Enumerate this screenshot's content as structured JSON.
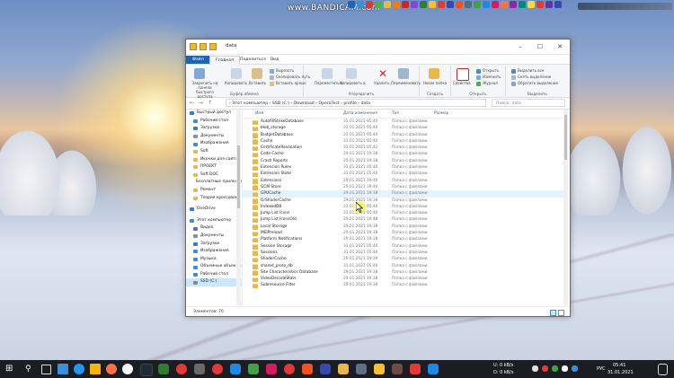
{
  "watermark": "www.BANDICAM.com",
  "window": {
    "title": "data",
    "tabs": [
      "Файл",
      "Главная",
      "Поделиться",
      "Вид"
    ],
    "ribbon": {
      "clipboard": {
        "pin": "Закрепить на панели быстрого доступа",
        "copy": "Копировать",
        "paste": "Вставить",
        "cut": "Вырезать",
        "copy_path": "Скопировать путь",
        "paste_shortcut": "Вставить ярлык",
        "group": "Буфер обмена"
      },
      "organize": {
        "move": "Переместить в",
        "copy": "Копировать в",
        "delete": "Удалить",
        "rename": "Переименовать",
        "group": "Упорядочить"
      },
      "new": {
        "folder": "Новая папка",
        "group": "Создать"
      },
      "open": {
        "properties": "Свойства",
        "open": "Открыть",
        "edit": "Изменить",
        "history": "Журнал",
        "group": "Открыть"
      },
      "select": {
        "all": "Выделить все",
        "none": "Снять выделение",
        "invert": "Обратить выделение",
        "group": "Выделить"
      }
    },
    "address": {
      "path": "› Этот компьютер  ›  SSD (C:)  ›  Download  ›  OperaTest  ›  profile  ›  data",
      "search_placeholder": "Поиск: data"
    },
    "nav_items": [
      {
        "label": "Быстрый доступ",
        "color": "#2f7fd8"
      },
      {
        "label": "Рабочий стол",
        "color": "#3b8fd9"
      },
      {
        "label": "Загрузки",
        "color": "#2f7fd8"
      },
      {
        "label": "Документы",
        "color": "#7f93a8"
      },
      {
        "label": "Изображения",
        "color": "#3b8fd9"
      },
      {
        "label": "Soft",
        "color": "#e9b84a"
      },
      {
        "label": "Иконки для сайта",
        "color": "#e9b84a"
      },
      {
        "label": "ПРОЕКТ",
        "color": "#e9b84a"
      },
      {
        "label": "Soft DOC",
        "color": "#e9b84a"
      },
      {
        "label": "Бесплатные приложения",
        "color": "#e9b84a"
      },
      {
        "label": "Ремонт",
        "color": "#e9b84a"
      },
      {
        "label": "Теория кроссовок",
        "color": "#e9b84a"
      },
      {
        "label": "OneDrive",
        "color": "#2f7fd8"
      },
      {
        "label": "Этот компьютер",
        "color": "#3b8fd9"
      },
      {
        "label": "Видео",
        "color": "#6a6aa8"
      },
      {
        "label": "Документы",
        "color": "#7f93a8"
      },
      {
        "label": "Загрузки",
        "color": "#2f7fd8"
      },
      {
        "label": "Изображения",
        "color": "#3b8fd9"
      },
      {
        "label": "Музыка",
        "color": "#3b8fd9"
      },
      {
        "label": "Объемные объекты",
        "color": "#3b8fd9"
      },
      {
        "label": "Рабочий стол",
        "color": "#3b8fd9"
      },
      {
        "label": "SSD (C:)",
        "color": "#888888"
      }
    ],
    "columns": {
      "name": "Имя",
      "date": "Дата изменения",
      "type": "Тип",
      "size": "Размер"
    },
    "files": [
      {
        "name": "AutofillStrikeDatabase",
        "date": "31.01.2021 05:40",
        "type": "Папка с файлами"
      },
      {
        "name": "blob_storage",
        "date": "31.01.2021 05:40",
        "type": "Папка с файлами"
      },
      {
        "name": "BudgetDatabase",
        "date": "31.01.2021 05:40",
        "type": "Папка с файлами"
      },
      {
        "name": "Cache",
        "date": "31.01.2021 05:40",
        "type": "Папка с файлами"
      },
      {
        "name": "CertificateRevocation",
        "date": "31.01.2021 05:41",
        "type": "Папка с файлами"
      },
      {
        "name": "Code Cache",
        "date": "29.01.2021 19:38",
        "type": "Папка с файлами"
      },
      {
        "name": "Crash Reports",
        "date": "29.01.2021 19:38",
        "type": "Папка с файлами"
      },
      {
        "name": "Extension Rules",
        "date": "31.01.2021 05:40",
        "type": "Папка с файлами"
      },
      {
        "name": "Extension State",
        "date": "31.01.2021 05:40",
        "type": "Папка с файлами"
      },
      {
        "name": "Extensions",
        "date": "29.01.2021 19:46",
        "type": "Папка с файлами"
      },
      {
        "name": "GCM Store",
        "date": "29.01.2021 19:40",
        "type": "Папка с файлами"
      },
      {
        "name": "GPUCache",
        "date": "29.01.2021 19:38",
        "type": "Папка с файлами"
      },
      {
        "name": "GrShaderCache",
        "date": "29.01.2021 19:38",
        "type": "Папка с файлами"
      },
      {
        "name": "IndexedDB",
        "date": "31.01.2021 05:40",
        "type": "Папка с файлами"
      },
      {
        "name": "Jump List Icons",
        "date": "31.01.2021 05:40",
        "type": "Папка с файлами"
      },
      {
        "name": "Jump List IconsOld",
        "date": "29.01.2021 19:48",
        "type": "Папка с файлами"
      },
      {
        "name": "Local Storage",
        "date": "29.01.2021 19:38",
        "type": "Папка с файлами"
      },
      {
        "name": "MEIPreload",
        "date": "29.01.2021 19:38",
        "type": "Папка с файлами"
      },
      {
        "name": "Platform Notifications",
        "date": "29.01.2021 19:38",
        "type": "Папка с файлами"
      },
      {
        "name": "Session Storage",
        "date": "31.01.2021 05:40",
        "type": "Папка с файлами"
      },
      {
        "name": "Sessions",
        "date": "31.01.2021 05:40",
        "type": "Папка с файлами"
      },
      {
        "name": "ShaderCache",
        "date": "29.01.2021 19:39",
        "type": "Папка с файлами"
      },
      {
        "name": "shared_proto_db",
        "date": "31.01.2021 05:40",
        "type": "Папка с файлами"
      },
      {
        "name": "Site Characteristics Database",
        "date": "29.01.2021 19:38",
        "type": "Папка с файлами"
      },
      {
        "name": "VideoDecodeStats",
        "date": "29.01.2021 19:38",
        "type": "Папка с файлами"
      },
      {
        "name": "Subresource Filter",
        "date": "29.01.2021 19:38",
        "type": "Папка с файлами"
      }
    ],
    "highlight_row": "GPUCache",
    "status": "Элементов: 76"
  },
  "taskbar": {
    "net_up": "0 kB/s",
    "net_down": "0 kB/s",
    "lang": "РУС",
    "time": "05:41",
    "date": "31.01.2021"
  },
  "colors": {
    "accent": "#1b64b7",
    "folder": "#e9b84a",
    "selection": "#cce8ff"
  }
}
